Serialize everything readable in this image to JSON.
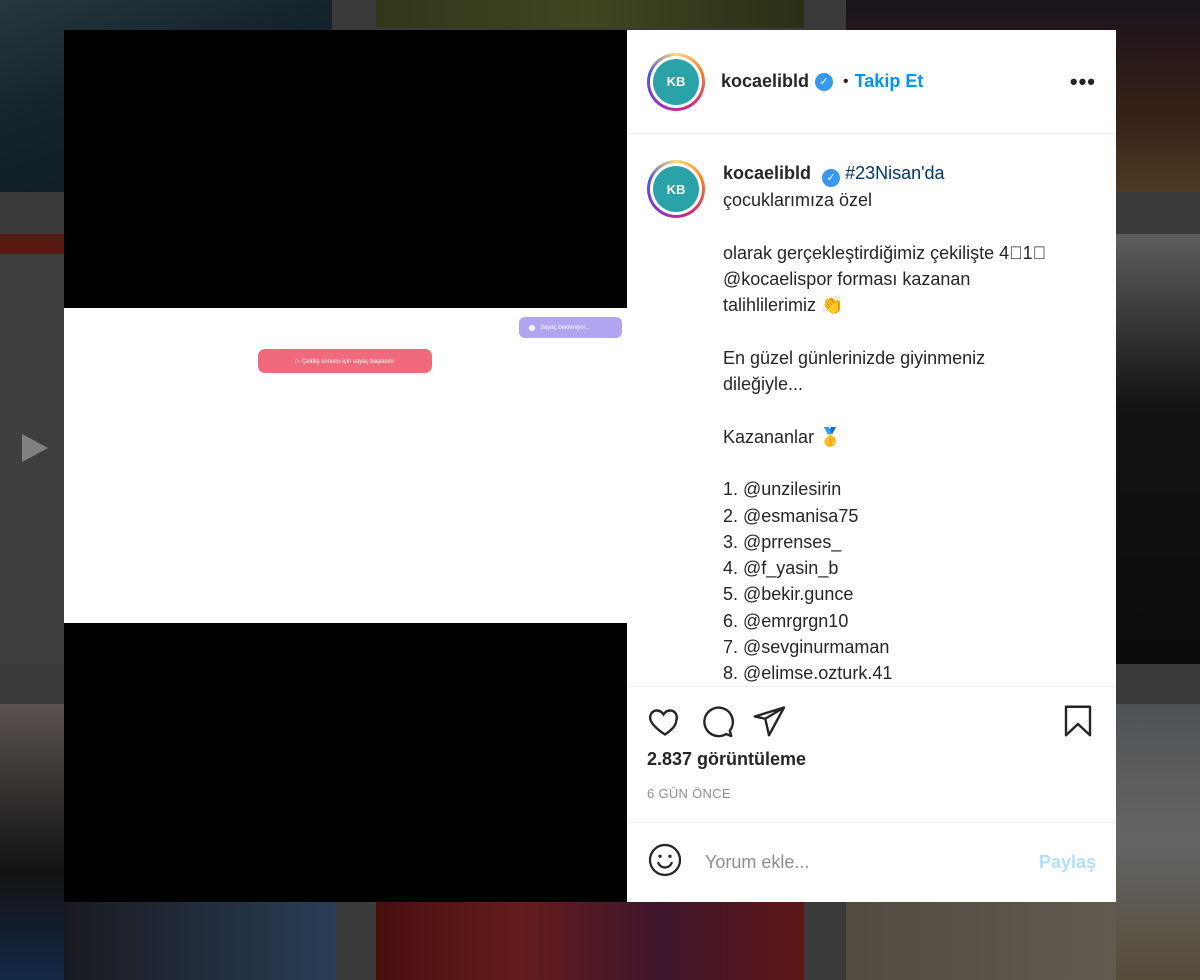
{
  "header": {
    "username": "kocaelibld",
    "follow_label": "Takip Et",
    "separator": "•",
    "more_label": "•••",
    "avatar_text": "KB"
  },
  "video": {
    "counter_label": "Sayaç bekleniyor...",
    "start_label": "▷ Çekiliş sonucu için sayaç başlasın!"
  },
  "caption": {
    "username": "kocaelibld",
    "hashtag": "#23Nisan'da",
    "lines": [
      "çocuklarımıza özel",
      "",
      "olarak gerçekleştirdiğimiz çekilişte 4⃣1⃣",
      "@kocaelispor forması kazanan",
      "talihlilerimiz 👏",
      "",
      "En güzel günlerinizde giyinmeniz",
      "dileğiyle...",
      "",
      "Kazananlar 🥇",
      "",
      "1. @unzilesirin",
      "2. @esmanisa75",
      "3. @prrenses_",
      "4. @f_yasin_b",
      "5. @bekir.gunce",
      "6. @emrgrgn10",
      "7. @sevginurmaman",
      "8. @elimse.ozturk.41"
    ]
  },
  "actions": {
    "views": "2.837 görüntüleme",
    "time": "6 GÜN ÖNCE"
  },
  "comment": {
    "placeholder": "Yorum ekle...",
    "share_label": "Paylaş"
  },
  "icons": [
    "heart-icon",
    "comment-icon",
    "share-icon",
    "bookmark-icon",
    "emoji-icon",
    "verified-icon",
    "play-icon"
  ],
  "colors": {
    "accent": "#0095f6",
    "verified": "#3897f0",
    "counter_pill": "#b3a4f0",
    "start_pill": "#f06a7c"
  }
}
